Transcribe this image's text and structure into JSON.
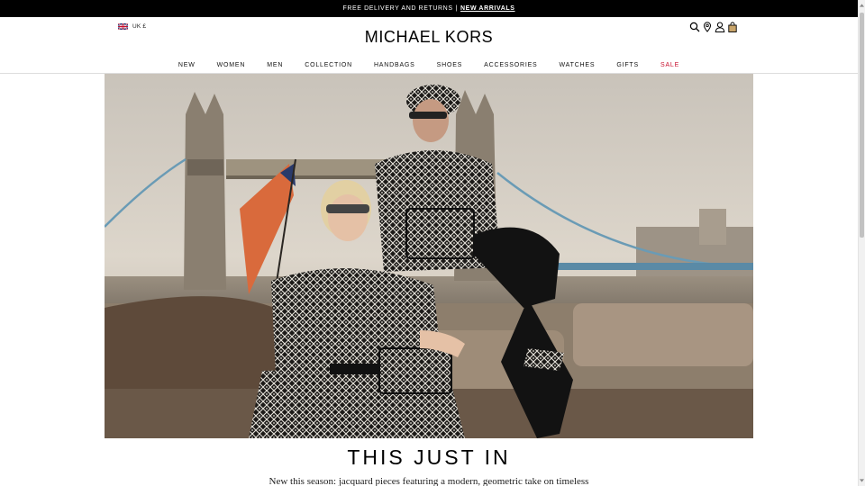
{
  "promo": {
    "text": "FREE DELIVERY AND RETURNS",
    "separator": "|",
    "link_label": "NEW ARRIVALS"
  },
  "locale": {
    "label": "UK £",
    "flag_icon": "uk-flag-icon"
  },
  "brand": {
    "logo_text": "MICHAEL KORS"
  },
  "header_icons": [
    "search-icon",
    "store-locator-icon",
    "account-icon",
    "shopping-bag-icon"
  ],
  "nav": {
    "items": [
      {
        "label": "NEW"
      },
      {
        "label": "WOMEN"
      },
      {
        "label": "MEN"
      },
      {
        "label": "COLLECTION"
      },
      {
        "label": "HANDBAGS"
      },
      {
        "label": "SHOES"
      },
      {
        "label": "ACCESSORIES"
      },
      {
        "label": "WATCHES"
      },
      {
        "label": "GIFTS"
      },
      {
        "label": "SALE"
      }
    ],
    "sale_color": "#c8102e"
  },
  "hero": {
    "image_name": "hero-campaign-image"
  },
  "section": {
    "title": "THIS JUST IN",
    "description": "New this season: jacquard pieces featuring a modern, geometric take on timeless"
  },
  "colors": {
    "promo_bg": "#000000",
    "promo_text": "#ffffff",
    "text": "#000000"
  }
}
